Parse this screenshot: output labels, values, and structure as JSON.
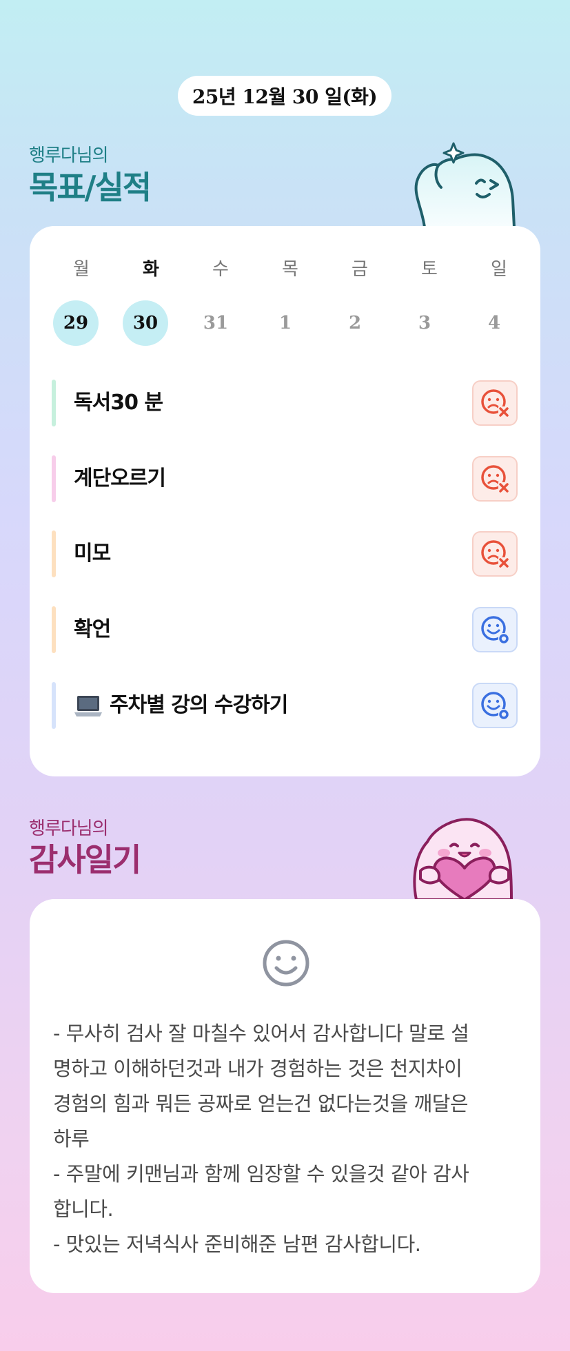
{
  "date": "25년 12월 30 일(화)",
  "goals_section": {
    "subtitle": "행루다님의",
    "title": "목표/실적"
  },
  "week": {
    "days": [
      {
        "name": "월",
        "num": "29"
      },
      {
        "name": "화",
        "num": "30"
      },
      {
        "name": "수",
        "num": "31"
      },
      {
        "name": "목",
        "num": "1"
      },
      {
        "name": "금",
        "num": "2"
      },
      {
        "name": "토",
        "num": "3"
      },
      {
        "name": "일",
        "num": "4"
      }
    ]
  },
  "goals": [
    {
      "label": "독서30 분",
      "status": "fail",
      "bar_color": "#c6f0dd"
    },
    {
      "label": "계단오르기",
      "status": "fail",
      "bar_color": "#f7cdea"
    },
    {
      "label": "미모",
      "status": "fail",
      "bar_color": "#fde0bf"
    },
    {
      "label": "확언",
      "status": "done",
      "bar_color": "#fde0bf"
    },
    {
      "label": "주차별 강의 수강하기",
      "status": "done",
      "bar_color": "#d6e3fb",
      "icon": "laptop-icon"
    }
  ],
  "gratitude_section": {
    "subtitle": "행루다님의",
    "title": "감사일기"
  },
  "diary": {
    "mood_icon": "smile-icon",
    "lines": [
      "- 무사히 검사 잘 마칠수 있어서 감사합니다 말로 설",
      "명하고 이해하던것과 내가 경험하는 것은 천지차이",
      "경험의 힘과 뭐든 공짜로 얻는건 없다는것을 깨달은",
      "하루",
      "- 주말에 키맨님과 함께 임장할 수 있을것 같아 감사",
      "합니다.",
      "- 맛있는 저녁식사 준비해준 남편 감사합니다."
    ]
  },
  "colors": {
    "teal": "#1f7f86",
    "plum": "#9b2e6e",
    "fail": "#e8513a",
    "done": "#3a6fe0",
    "today_circle": "#c5eef4"
  }
}
